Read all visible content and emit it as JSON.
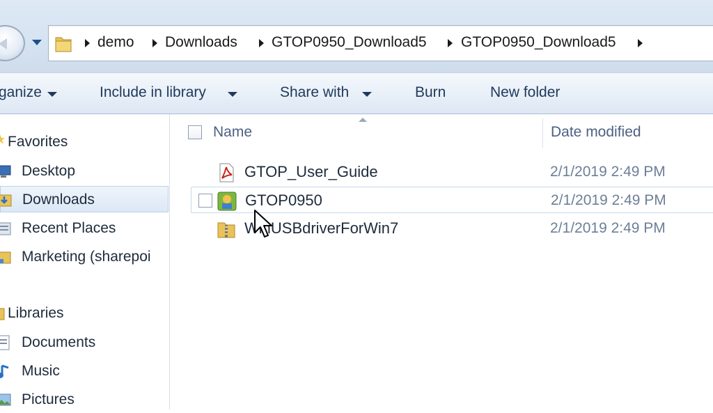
{
  "address_bar": {
    "crumbs": [
      "demo",
      "Downloads",
      "GTOP0950_Download5",
      "GTOP0950_Download5"
    ]
  },
  "toolbar": {
    "organize_label": "ganize",
    "include_label": "Include in library",
    "share_label": "Share with",
    "burn_label": "Burn",
    "new_folder_label": "New folder"
  },
  "nav": {
    "favorites_header": "Favorites",
    "favorites": [
      {
        "label": "Desktop",
        "icon": "desktop-icon"
      },
      {
        "label": "Downloads",
        "icon": "downloads-icon"
      },
      {
        "label": "Recent Places",
        "icon": "recent-places-icon"
      },
      {
        "label": "Marketing (sharepoi",
        "icon": "sharepoint-folder-icon"
      }
    ],
    "libraries_header": "Libraries",
    "libraries": [
      {
        "label": "Documents",
        "icon": "documents-icon"
      },
      {
        "label": "Music",
        "icon": "music-icon"
      },
      {
        "label": "Pictures",
        "icon": "pictures-icon"
      }
    ]
  },
  "file_list": {
    "columns": {
      "name": "Name",
      "date": "Date modified"
    },
    "rows": [
      {
        "name": "GTOP_User_Guide",
        "date": "2/1/2019 2:49 PM",
        "icon": "pdf-icon"
      },
      {
        "name": "GTOP0950",
        "date": "2/1/2019 2:49 PM",
        "icon": "application-icon"
      },
      {
        "name": "WinUSBdriverForWin7",
        "date": "2/1/2019 2:49 PM",
        "icon": "zip-folder-icon"
      }
    ]
  },
  "colors": {
    "toolbar_text": "#1e395b",
    "date_text": "#6d7f97",
    "header_text": "#4d6082"
  }
}
